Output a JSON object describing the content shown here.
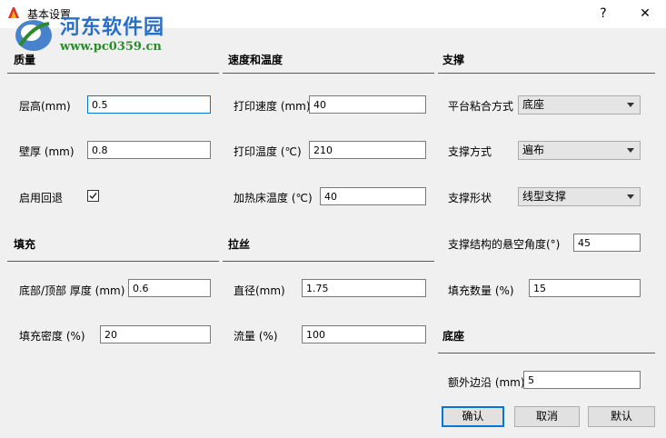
{
  "window": {
    "title": "基本设置",
    "help_label": "?",
    "close_label": "✕"
  },
  "watermark": {
    "title": "河东软件园",
    "url": "www.pc0359.cn"
  },
  "quality": {
    "heading": "质量",
    "layer_height_label": "层高(mm)",
    "layer_height_value": "0.5",
    "wall_thickness_label": "壁厚 (mm)",
    "wall_thickness_value": "0.8",
    "retraction_label": "启用回退",
    "retraction_checked": true
  },
  "fill": {
    "heading": "填充",
    "bottom_top_label": "底部/顶部 厚度 (mm)",
    "bottom_top_value": "0.6",
    "density_label": "填充密度 (%)",
    "density_value": "20"
  },
  "speed_temp": {
    "heading": "速度和温度",
    "print_speed_label": "打印速度 (mm)",
    "print_speed_value": "40",
    "print_temp_label": "打印温度 (℃)",
    "print_temp_value": "210",
    "bed_temp_label": "加热床温度 (℃)",
    "bed_temp_value": "40"
  },
  "filament": {
    "heading": "拉丝",
    "diameter_label": "直径(mm)",
    "diameter_value": "1.75",
    "flow_label": "流量 (%)",
    "flow_value": "100"
  },
  "support": {
    "heading": "支撑",
    "adhesion_label": "平台粘合方式",
    "adhesion_value": "底座",
    "type_label": "支撑方式",
    "type_value": "遍布",
    "shape_label": "支撑形状",
    "shape_value": "线型支撑",
    "overhang_label": "支撑结构的悬空角度(°)",
    "overhang_value": "45",
    "fill_amount_label": "填充数量 (%)",
    "fill_amount_value": "15"
  },
  "brim": {
    "heading": "底座",
    "extra_margin_label": "额外边沿 (mm)",
    "extra_margin_value": "5"
  },
  "buttons": {
    "ok": "确认",
    "cancel": "取消",
    "default": "默认"
  }
}
